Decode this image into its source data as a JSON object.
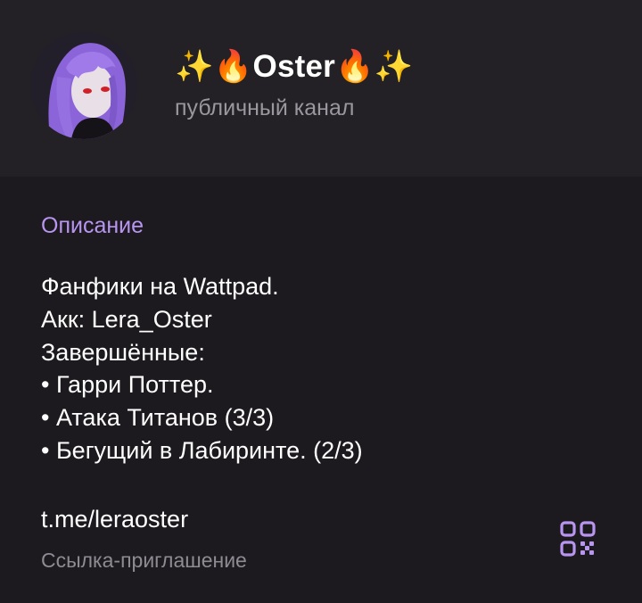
{
  "channel": {
    "title": "✨🔥Oster🔥✨",
    "type_label": "публичный канал"
  },
  "info": {
    "section_title": "Описание",
    "description_lines": [
      "Фанфики на Wattpad.",
      "Акк: Lera_Oster",
      "Завершённые:",
      "• Гарри Поттер.",
      "• Атака Титанов (3/3)",
      "• Бегущий в Лабиринте. (2/3)"
    ],
    "link": "t.me/leraoster",
    "link_caption": "Ссылка-приглашение"
  },
  "icons": {
    "qr": "qr-code-icon",
    "avatar": "channel-avatar"
  },
  "colors": {
    "accent": "#b895f1",
    "header_bg": "#232125",
    "body_bg": "#1c1a1e",
    "secondary_text": "#9a979e"
  }
}
